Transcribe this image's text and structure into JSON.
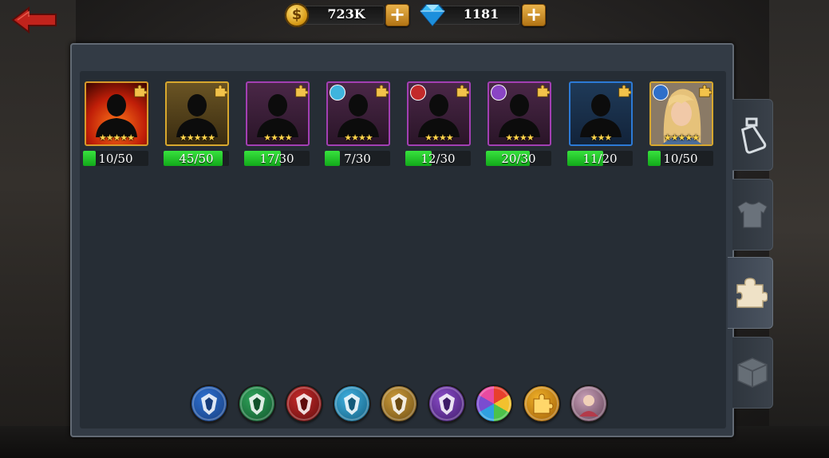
{
  "header": {
    "gold": "723K",
    "gems": "1181",
    "gold_icon_glyph": "$",
    "plus_glyph": "+"
  },
  "colors": {
    "panel": "#333b45",
    "progress": "#1fc227",
    "star": "#ffd54a"
  },
  "heroes": [
    {
      "progress": "10/50",
      "fraction": 0.2,
      "stars": "★★★★★",
      "rarity": "legendary-red",
      "faction": "none"
    },
    {
      "progress": "45/50",
      "fraction": 0.9,
      "stars": "★★★★★",
      "rarity": "legendary-gold",
      "faction": "none"
    },
    {
      "progress": "17/30",
      "fraction": 0.567,
      "stars": "★★★★",
      "rarity": "epic-purple",
      "faction": "none"
    },
    {
      "progress": "7/30",
      "fraction": 0.233,
      "stars": "★★★★",
      "rarity": "epic-purple",
      "faction": "skull"
    },
    {
      "progress": "12/30",
      "fraction": 0.4,
      "stars": "★★★★",
      "rarity": "epic-purple",
      "faction": "red"
    },
    {
      "progress": "20/30",
      "fraction": 0.667,
      "stars": "★★★★",
      "rarity": "epic-purple",
      "faction": "purple"
    },
    {
      "progress": "11/20",
      "fraction": 0.55,
      "stars": "★★★",
      "rarity": "rare-blue",
      "faction": "none"
    },
    {
      "progress": "10/50",
      "fraction": 0.2,
      "stars": "★★★★★",
      "rarity": "legendary-gold",
      "faction": "blue",
      "portrait": "blonde-hero"
    }
  ],
  "side_tabs": [
    "potion-icon",
    "armor-icon",
    "puzzle-icon",
    "box-icon"
  ],
  "filters": [
    "blue-faction-icon",
    "green-faction-icon",
    "red-faction-icon",
    "skull-faction-icon",
    "gold-faction-icon",
    "purple-faction-icon",
    "all-colors-icon",
    "puzzle-filter-icon",
    "hero-portrait-icon"
  ]
}
